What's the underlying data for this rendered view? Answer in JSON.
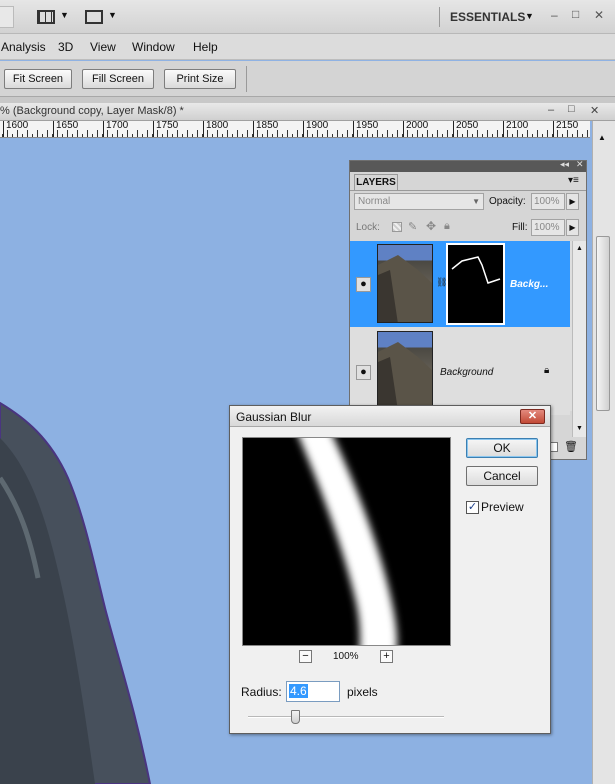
{
  "titlebar": {
    "workspace": "ESSENTIALS",
    "minimize": "–",
    "maximize": "□",
    "close": "✕"
  },
  "menu": [
    "Analysis",
    "3D",
    "View",
    "Window",
    "Help"
  ],
  "options": {
    "fit_screen": "Fit Screen",
    "fill_screen": "Fill Screen",
    "print_size": "Print Size"
  },
  "document": {
    "tab_title": "% (Background copy, Layer Mask/8) *"
  },
  "ruler": {
    "ticks": [
      "1600",
      "1650",
      "1700",
      "1750",
      "1800",
      "1850",
      "1900",
      "1950",
      "2000",
      "2050",
      "2100",
      "2150"
    ]
  },
  "layers": {
    "tab": "LAYERS",
    "blend_mode": "Normal",
    "opacity_label": "Opacity:",
    "opacity_value": "100%",
    "lock_label": "Lock:",
    "fill_label": "Fill:",
    "fill_value": "100%",
    "items": [
      {
        "name": "Backg...",
        "selected": true,
        "has_mask": true
      },
      {
        "name": "Background",
        "selected": false,
        "locked": true
      }
    ]
  },
  "gaussian_blur": {
    "title": "Gaussian Blur",
    "ok": "OK",
    "cancel": "Cancel",
    "preview_label": "Preview",
    "preview_checked": true,
    "zoom": "100%",
    "zoom_out": "−",
    "zoom_in": "+",
    "radius_label": "Radius:",
    "radius_value": "4.6",
    "radius_unit": "pixels",
    "slider_fraction": 0.24
  },
  "colors": {
    "canvas_sky": "#8db1e2",
    "selected_layer": "#3399ff",
    "accent_close": "#c24a36"
  }
}
